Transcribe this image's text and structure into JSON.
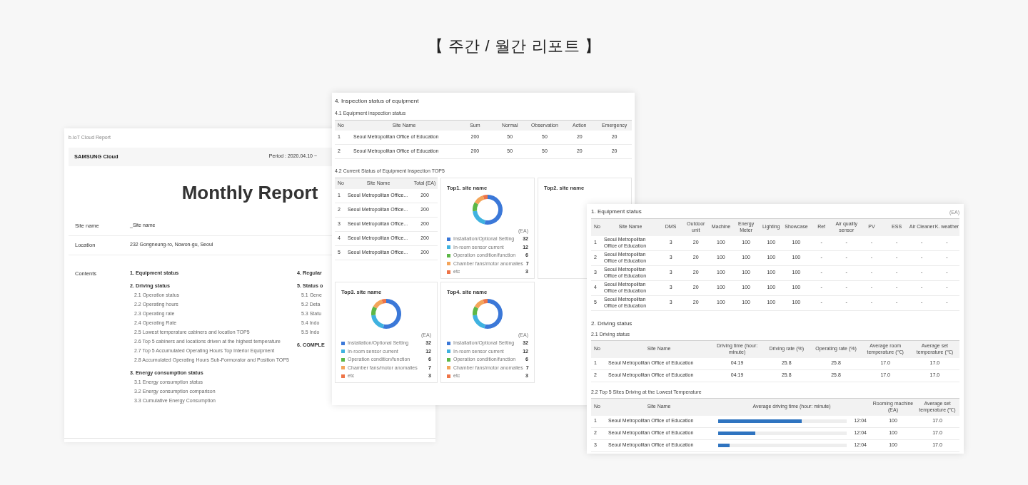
{
  "heading": "【 주간 / 월간 리포트 】",
  "cover_page": {
    "caption": "b.IoT Cloud Report",
    "brand": "SAMSUNG Cloud",
    "period": "Period : 2020.04.10 ~",
    "title": "Monthly Report",
    "fields": [
      {
        "label": "Site name",
        "value": "_Site name"
      },
      {
        "label": "Location",
        "value": "232 Gongneung-ro, Nowon-gu, Seoul"
      }
    ],
    "contents_label": "Contents",
    "contents_columns": [
      [
        {
          "title": "1. Equipment status"
        },
        {
          "title": "2. Driving status",
          "children": [
            "2.1 Operation status",
            "2.2 Operating hours",
            "2.3 Operating rate",
            "2.4 Operating Rate",
            "2.5 Lowest temperature cabiners and location TOP5",
            "2.6 Top 5 cabiners and locations driven at the highest temperature",
            "2.7 Top 5 Accumulated Operating Hours Top Interior Equipment",
            "2.8 Accumulated Operating Hours Sub-Formorator and Position TOP5"
          ]
        },
        {
          "title": "3. Energy consumption status",
          "children": [
            "3.1 Energy consumption status",
            "3.2 Energy consumption comparison",
            "3.3 Cumulative Energy Consumption"
          ]
        }
      ],
      [
        {
          "title": "4. Regular"
        },
        {
          "title": "5. Status o",
          "children": [
            "5.1 Gene",
            "5.2 Deta",
            "5.3 Statu",
            "5.4 Indo",
            "5.5 Indo"
          ]
        },
        {
          "title": "6. COMPLE"
        }
      ]
    ]
  },
  "inspection_page": {
    "title": "4. Inspection status of equipment",
    "inspection_table": {
      "title": "4.1 Equipment inspection status",
      "columns": [
        "No",
        "Site Name",
        "Sum",
        "Normal",
        "Observation",
        "Action",
        "Emergency"
      ],
      "rows": [
        [
          "1",
          "Seoul Metropolitan Office of Education",
          "200",
          "50",
          "50",
          "20",
          "20"
        ],
        [
          "2",
          "Seoul Metropolitan Office of Education",
          "200",
          "50",
          "50",
          "20",
          "20"
        ]
      ]
    },
    "top5": {
      "title": "4.2 Current Status of Equipment Inspection TOP5",
      "table": {
        "columns": [
          "No",
          "Site Name",
          "Total (EA)"
        ],
        "rows": [
          [
            "1",
            "Seoul Metropolitan Office...",
            "200"
          ],
          [
            "2",
            "Seoul Metropolitan Office...",
            "200"
          ],
          [
            "3",
            "Seoul Metropolitan Office...",
            "200"
          ],
          [
            "4",
            "Seoul Metropolitan Office...",
            "200"
          ],
          [
            "5",
            "Seoul Metropolitan Office...",
            "200"
          ]
        ]
      },
      "cards": [
        {
          "title": "Top1. site name",
          "unit": "(EA)",
          "chart_data": {
            "type": "donut",
            "values": [
              53.33,
              20,
              10,
              11.67,
              5
            ]
          },
          "legend": [
            {
              "label": "Installation/Optional Setting",
              "value": "32",
              "color": "#3b78d8"
            },
            {
              "label": "In-room sensor current",
              "value": "12",
              "color": "#3fb2e0"
            },
            {
              "label": "Operation condition/function",
              "value": "6",
              "color": "#5cb746"
            },
            {
              "label": "Chamber fans/motor anomalies",
              "value": "7",
              "color": "#f4a55a"
            },
            {
              "label": "etc",
              "value": "3",
              "color": "#ee7448"
            }
          ]
        },
        {
          "title": "Top2. site name"
        },
        {
          "title": "Top3. site name",
          "unit": "(EA)",
          "chart_data": {
            "type": "donut",
            "values": [
              53.33,
              20,
              10,
              11.67,
              5
            ]
          },
          "legend": [
            {
              "label": "Installation/Optional Setting",
              "value": "32",
              "color": "#3b78d8"
            },
            {
              "label": "In-room sensor current",
              "value": "12",
              "color": "#3fb2e0"
            },
            {
              "label": "Operation condition/function",
              "value": "6",
              "color": "#5cb746"
            },
            {
              "label": "Chamber fans/motor anomalies",
              "value": "7",
              "color": "#f4a55a"
            },
            {
              "label": "etc",
              "value": "3",
              "color": "#ee7448"
            }
          ]
        },
        {
          "title": "Top4. site name",
          "unit": "(EA)",
          "chart_data": {
            "type": "donut",
            "values": [
              53.33,
              20,
              10,
              11.67,
              5
            ]
          },
          "legend": [
            {
              "label": "Installation/Optional Setting",
              "value": "32",
              "color": "#3b78d8"
            },
            {
              "label": "In-room sensor current",
              "value": "12",
              "color": "#3fb2e0"
            },
            {
              "label": "Operation condition/function",
              "value": "6",
              "color": "#5cb746"
            },
            {
              "label": "Chamber fans/motor anomalies",
              "value": "7",
              "color": "#f4a55a"
            },
            {
              "label": "etc",
              "value": "3",
              "color": "#ee7448"
            }
          ]
        }
      ]
    }
  },
  "status_page": {
    "equipment": {
      "title": "1. Equipment status",
      "unit": "(EA)",
      "columns": [
        "No",
        "Site Name",
        "DMS",
        "Outdoor unit",
        "Machine",
        "Energy Meter",
        "Lighting",
        "Showcase",
        "Ref",
        "Air quality sensor",
        "PV",
        "ESS",
        "Air Cleaner",
        "K. weather"
      ],
      "rows": [
        [
          "1",
          "Seoul Metropolitan Office of Education",
          "3",
          "20",
          "100",
          "100",
          "100",
          "100",
          "-",
          "-",
          "-",
          "-",
          "-",
          "-"
        ],
        [
          "2",
          "Seoul Metropolitan Office of Education",
          "3",
          "20",
          "100",
          "100",
          "100",
          "100",
          "-",
          "-",
          "-",
          "-",
          "-",
          "-"
        ],
        [
          "3",
          "Seoul Metropolitan Office of Education",
          "3",
          "20",
          "100",
          "100",
          "100",
          "100",
          "-",
          "-",
          "-",
          "-",
          "-",
          "-"
        ],
        [
          "4",
          "Seoul Metropolitan Office of Education",
          "3",
          "20",
          "100",
          "100",
          "100",
          "100",
          "-",
          "-",
          "-",
          "-",
          "-",
          "-"
        ],
        [
          "5",
          "Seoul Metropolitan Office of Education",
          "3",
          "20",
          "100",
          "100",
          "100",
          "100",
          "-",
          "-",
          "-",
          "-",
          "-",
          "-"
        ]
      ]
    },
    "driving": {
      "title": "2. Driving status",
      "status_table": {
        "title": "2.1 Driving status",
        "columns": [
          "No",
          "Site Name",
          "Driving time (hour: minute)",
          "Driving rate (%)",
          "Operating rate (%)",
          "Average room temperature (℃)",
          "Average set temperature (℃)"
        ],
        "rows": [
          [
            "1",
            "Seoul Metropolitan Office of Education",
            "04:19",
            "25.8",
            "25.8",
            "17.0",
            "17.0"
          ],
          [
            "2",
            "Seoul Metropolitan Office of Education",
            "04:19",
            "25.8",
            "25.8",
            "17.0",
            "17.0"
          ]
        ]
      },
      "lowest_table": {
        "title": "2.2 Top 5 Sites Driving at the Lowest Temperature",
        "columns": [
          "No",
          "Site Name",
          "Average driving time (hour: minute)",
          "Rooming machine (EA)",
          "Average set temperature (℃)"
        ],
        "rows": [
          {
            "no": "1",
            "site": "Seoul Metropolitan Office of Education",
            "level": 0.65,
            "time": "12:04",
            "machines": "100",
            "set_temp": "17.0"
          },
          {
            "no": "2",
            "site": "Seoul Metropolitan Office of Education",
            "level": 0.29,
            "time": "12:04",
            "machines": "100",
            "set_temp": "17.0"
          },
          {
            "no": "3",
            "site": "Seoul Metropolitan Office of Education",
            "level": 0.09,
            "time": "12:04",
            "machines": "100",
            "set_temp": "17.0"
          }
        ]
      }
    }
  }
}
